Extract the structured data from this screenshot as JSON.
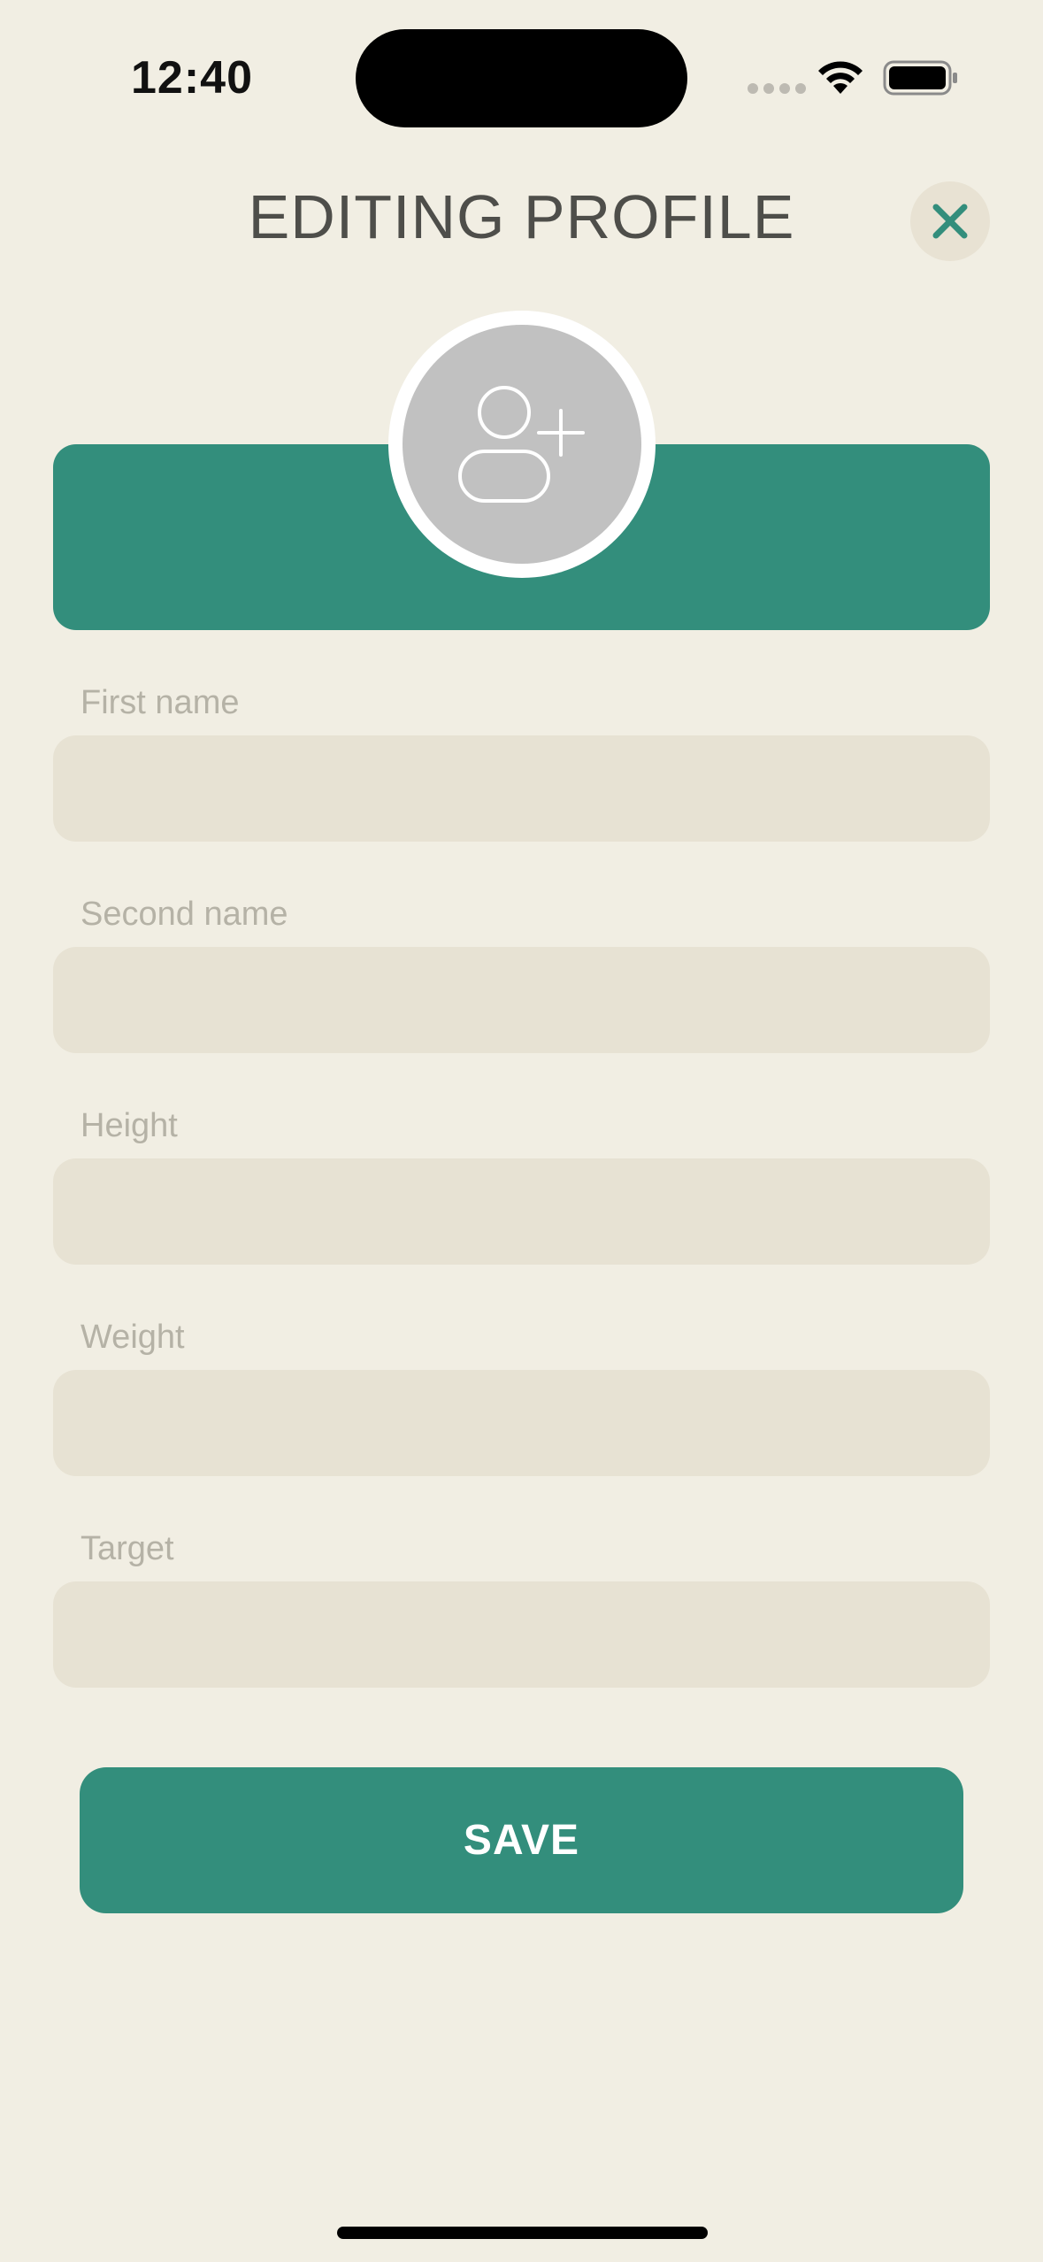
{
  "status_bar": {
    "time": "12:40"
  },
  "header": {
    "title": "EDITING PROFILE",
    "close_icon": "close-icon"
  },
  "avatar": {
    "icon": "add-user-icon"
  },
  "form": {
    "fields": [
      {
        "label": "First name",
        "value": "",
        "placeholder": ""
      },
      {
        "label": "Second name",
        "value": "",
        "placeholder": ""
      },
      {
        "label": "Height",
        "value": "",
        "placeholder": ""
      },
      {
        "label": "Weight",
        "value": "",
        "placeholder": ""
      },
      {
        "label": "Target",
        "value": "",
        "placeholder": ""
      }
    ],
    "save_label": "SAVE"
  },
  "colors": {
    "background": "#f1eee3",
    "accent": "#338e7c",
    "field_bg": "#e7e2d3",
    "label": "#b5b2a6",
    "title": "#4e4e4a"
  }
}
